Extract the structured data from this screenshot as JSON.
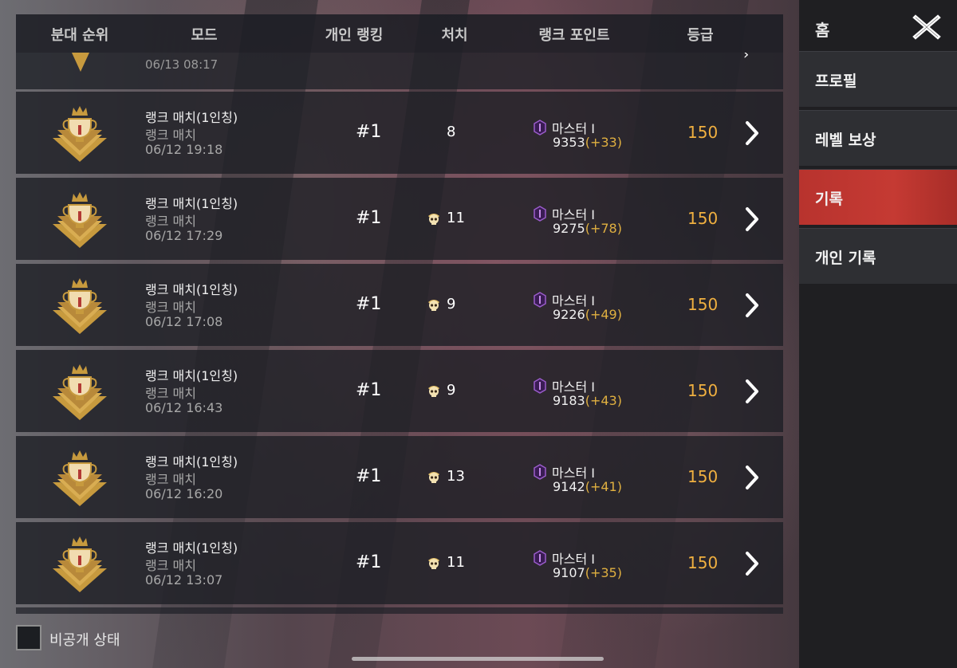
{
  "header": {
    "squad_rank": "분대 순위",
    "mode": "모드",
    "personal_rank": "개인 랭킹",
    "kills": "처치",
    "rank_points": "랭크 포인트",
    "grade": "등급"
  },
  "partial_row": {
    "date": "06/13 08:17"
  },
  "matches": [
    {
      "title": "랭크 매치(1인칭)",
      "mode": "랭크 매치",
      "date": "06/12 19:18",
      "rank": "#1",
      "kills": "8",
      "kill_icon": false,
      "tier": "마스터 I",
      "rp": "9353",
      "rp_delta": "(+33)",
      "grade": "150"
    },
    {
      "title": "랭크 매치(1인칭)",
      "mode": "랭크 매치",
      "date": "06/12 17:29",
      "rank": "#1",
      "kills": "11",
      "kill_icon": true,
      "tier": "마스터 I",
      "rp": "9275",
      "rp_delta": "(+78)",
      "grade": "150"
    },
    {
      "title": "랭크 매치(1인칭)",
      "mode": "랭크 매치",
      "date": "06/12 17:08",
      "rank": "#1",
      "kills": "9",
      "kill_icon": true,
      "tier": "마스터 I",
      "rp": "9226",
      "rp_delta": "(+49)",
      "grade": "150"
    },
    {
      "title": "랭크 매치(1인칭)",
      "mode": "랭크 매치",
      "date": "06/12 16:43",
      "rank": "#1",
      "kills": "9",
      "kill_icon": true,
      "tier": "마스터 I",
      "rp": "9183",
      "rp_delta": "(+43)",
      "grade": "150"
    },
    {
      "title": "랭크 매치(1인칭)",
      "mode": "랭크 매치",
      "date": "06/12 16:20",
      "rank": "#1",
      "kills": "13",
      "kill_icon": true,
      "tier": "마스터 I",
      "rp": "9142",
      "rp_delta": "(+41)",
      "grade": "150"
    },
    {
      "title": "랭크 매치(1인칭)",
      "mode": "랭크 매치",
      "date": "06/12 13:07",
      "rank": "#1",
      "kills": "11",
      "kill_icon": true,
      "tier": "마스터 I",
      "rp": "9107",
      "rp_delta": "(+35)",
      "grade": "150"
    }
  ],
  "menu": {
    "home": "홈",
    "items": [
      {
        "label": "프로필",
        "active": false
      },
      {
        "label": "레벨 보상",
        "active": false
      },
      {
        "label": "기록",
        "active": true
      },
      {
        "label": "개인 기록",
        "active": false
      }
    ]
  },
  "privacy": {
    "label": "비공개 상태"
  },
  "colors": {
    "accent_red": "#c53a33",
    "gold": "#c79a3e",
    "rp_delta": "#e0b040",
    "grade": "#f0b040",
    "tier_purple": "#7a3fa6"
  },
  "icons": {
    "badge": "champion-trophy-icon",
    "kill": "skull-icon",
    "tier": "master-tier-icon",
    "row_action": "chevron-right-icon",
    "close": "close-x-icon"
  }
}
